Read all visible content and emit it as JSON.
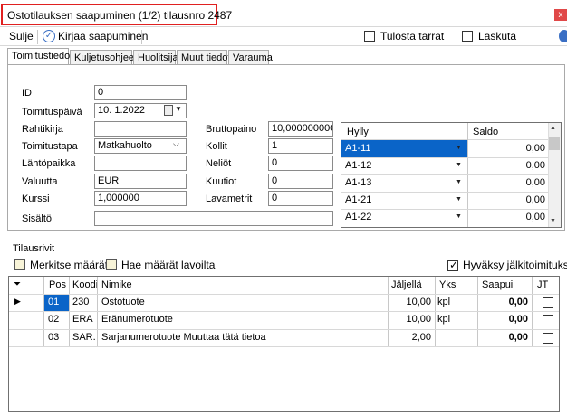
{
  "window": {
    "title": "Ostotilauksen saapuminen (1/2) tilausnro 2487",
    "close": "x"
  },
  "toolbar": {
    "close_label": "Sulje",
    "book_label": "Kirjaa saapuminen",
    "print_labels": "Tulosta tarrat",
    "invoice": "Laskuta"
  },
  "tabs": [
    "Toimitustiedot",
    "Kuljetusohjeet",
    "Huolitsija",
    "Muut tiedot",
    "Varauma"
  ],
  "form": {
    "id_label": "ID",
    "id_value": "0",
    "date_label": "Toimituspäivä",
    "date_value": "10.  1.2022",
    "waybill_label": "Rahtikirja",
    "waybill_value": "",
    "delivery_label": "Toimitustapa",
    "delivery_value": "Matkahuolto",
    "origin_label": "Lähtöpaikka",
    "origin_value": "",
    "currency_label": "Valuutta",
    "currency_value": "EUR",
    "rate_label": "Kurssi",
    "rate_value": "1,000000",
    "content_label": "Sisältö",
    "content_value": "",
    "gross_label": "Bruttopaino",
    "gross_value": "10,0000000000",
    "packages_label": "Kollit",
    "packages_value": "1",
    "sqm_label": "Neliöt",
    "sqm_value": "0",
    "cbm_label": "Kuutiot",
    "cbm_value": "0",
    "ldm_label": "Lavametrit",
    "ldm_value": "0"
  },
  "shelf_grid": {
    "headers": [
      "Hylly",
      "Saldo"
    ],
    "rows": [
      {
        "shelf": "A1-11",
        "balance": "0,00"
      },
      {
        "shelf": "A1-12",
        "balance": "0,00"
      },
      {
        "shelf": "A1-13",
        "balance": "0,00"
      },
      {
        "shelf": "A1-21",
        "balance": "0,00"
      },
      {
        "shelf": "A1-22",
        "balance": "0,00"
      }
    ]
  },
  "order_rows": {
    "section_label": "Tilausrivit",
    "mark_qty": "Merkitse määrät",
    "fetch_qty": "Hae määrät lavoilta",
    "approve_backorders": "Hyväksy jälkitoimitukset",
    "headers": [
      "Pos",
      "Koodi",
      "Nimike",
      "Jäljellä",
      "Yks",
      "Saapui",
      "JT"
    ],
    "rows": [
      {
        "pos": "01",
        "code": "230",
        "name": "Ostotuote",
        "remaining": "10,00",
        "unit": "kpl",
        "arrived": "0,00"
      },
      {
        "pos": "02",
        "code": "ERA",
        "name": "Eränumerotuote",
        "remaining": "10,00",
        "unit": "kpl",
        "arrived": "0,00"
      },
      {
        "pos": "03",
        "code": "SAR...",
        "name": "Sarjanumerotuote Muuttaa tätä tietoa",
        "remaining": "2,00",
        "unit": "",
        "arrived": "0,00"
      }
    ]
  }
}
